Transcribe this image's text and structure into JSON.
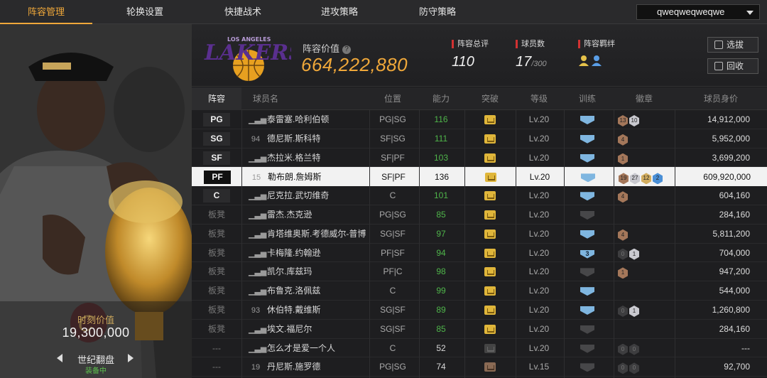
{
  "nav": {
    "tabs": [
      "阵容管理",
      "轮换设置",
      "快捷战术",
      "进攻策略",
      "防守策略"
    ],
    "active": 0,
    "account": "qweqweqweqwe"
  },
  "card": {
    "value_label": "时刻价值",
    "value": "19,300,000",
    "name": "世纪翻盘",
    "status": "装备中"
  },
  "header": {
    "team_logo_text": "LAKERS",
    "team_logo_sub": "LOS ANGELES",
    "value_label": "阵容价值",
    "value": "664,222,880",
    "rating_label": "阵容总评",
    "rating": "110",
    "count_label": "球员数",
    "count": "17",
    "count_max": "/300",
    "bond_label": "阵容羁绊",
    "btn_pick": "选拔",
    "btn_recycle": "回收"
  },
  "table": {
    "headers": [
      "阵容",
      "球员名",
      "位置",
      "能力",
      "突破",
      "等级",
      "训练",
      "徽章",
      "球员身价"
    ],
    "rows": [
      {
        "slot": "PG",
        "num": "",
        "name": "泰雷塞.哈利伯顿",
        "pos": "PG|SG",
        "ability": "116",
        "level": "Lv.20",
        "train": "",
        "badges": [
          [
            "bronze",
            "13"
          ],
          [
            "silver",
            "10"
          ]
        ],
        "value": "14,912,000"
      },
      {
        "slot": "SG",
        "num": "94",
        "name": "德尼斯.斯科特",
        "pos": "SF|SG",
        "ability": "111",
        "level": "Lv.20",
        "train": "",
        "badges": [
          [
            "bronze",
            "4"
          ]
        ],
        "value": "5,952,000"
      },
      {
        "slot": "SF",
        "num": "",
        "name": "杰拉米.格兰特",
        "pos": "SF|PF",
        "ability": "103",
        "level": "Lv.20",
        "train": "",
        "badges": [
          [
            "bronze",
            "1"
          ]
        ],
        "value": "3,699,200"
      },
      {
        "slot": "PF",
        "num": "15",
        "name": "勒布朗.詹姆斯",
        "pos": "SF|PF",
        "ability": "136",
        "level": "Lv.20",
        "train": "",
        "badges": [
          [
            "bronze",
            "19"
          ],
          [
            "silver",
            "27"
          ],
          [
            "gold",
            "12"
          ],
          [
            "blue",
            "2"
          ]
        ],
        "value": "609,920,000"
      },
      {
        "slot": "C",
        "num": "",
        "name": "尼克拉.武切维奇",
        "pos": "C",
        "ability": "101",
        "level": "Lv.20",
        "train": "",
        "badges": [
          [
            "bronze",
            "4"
          ]
        ],
        "value": "604,160"
      },
      {
        "slot": "板凳",
        "num": "",
        "name": "雷杰.杰克逊",
        "pos": "PG|SG",
        "ability": "85",
        "level": "Lv.20",
        "train": "off",
        "badges": [],
        "value": "284,160"
      },
      {
        "slot": "板凳",
        "num": "",
        "name": "肯塔维奥斯.考德威尔-普博",
        "pos": "SG|SF",
        "ability": "97",
        "level": "Lv.20",
        "train": "",
        "badges": [
          [
            "bronze",
            "4"
          ]
        ],
        "value": "5,811,200"
      },
      {
        "slot": "板凳",
        "num": "",
        "name": "卡梅隆.约翰逊",
        "pos": "PF|SF",
        "ability": "94",
        "level": "Lv.20",
        "train": "3",
        "badges": [
          [
            "dark",
            "0"
          ],
          [
            "silver",
            "1"
          ]
        ],
        "value": "704,000"
      },
      {
        "slot": "板凳",
        "num": "",
        "name": "凯尔.库兹玛",
        "pos": "PF|C",
        "ability": "98",
        "level": "Lv.20",
        "train": "off",
        "badges": [
          [
            "bronze",
            "1"
          ]
        ],
        "value": "947,200"
      },
      {
        "slot": "板凳",
        "num": "",
        "name": "布鲁克.洛佩兹",
        "pos": "C",
        "ability": "99",
        "level": "Lv.20",
        "train": "",
        "badges": [],
        "value": "544,000"
      },
      {
        "slot": "板凳",
        "num": "93",
        "name": "休伯特.戴维斯",
        "pos": "SG|SF",
        "ability": "89",
        "level": "Lv.20",
        "train": "",
        "badges": [
          [
            "dark",
            "0"
          ],
          [
            "silver",
            "1"
          ]
        ],
        "value": "1,260,800"
      },
      {
        "slot": "板凳",
        "num": "",
        "name": "埃文.福尼尔",
        "pos": "SG|SF",
        "ability": "85",
        "level": "Lv.20",
        "train": "off",
        "badges": [],
        "value": "284,160"
      },
      {
        "slot": "---",
        "num": "",
        "name": "怎么才是爱一个人",
        "pos": "C",
        "ability": "52",
        "level": "Lv.20",
        "train": "off",
        "badges": [
          [
            "dark",
            "0"
          ],
          [
            "dark",
            "0"
          ]
        ],
        "value": "---"
      },
      {
        "slot": "---",
        "num": "19",
        "name": "丹尼斯.施罗德",
        "pos": "PG|SG",
        "ability": "74",
        "level": "Lv.15",
        "train": "off",
        "badges": [
          [
            "dark",
            "0"
          ],
          [
            "dark",
            "0"
          ]
        ],
        "value": "92,700"
      }
    ]
  }
}
